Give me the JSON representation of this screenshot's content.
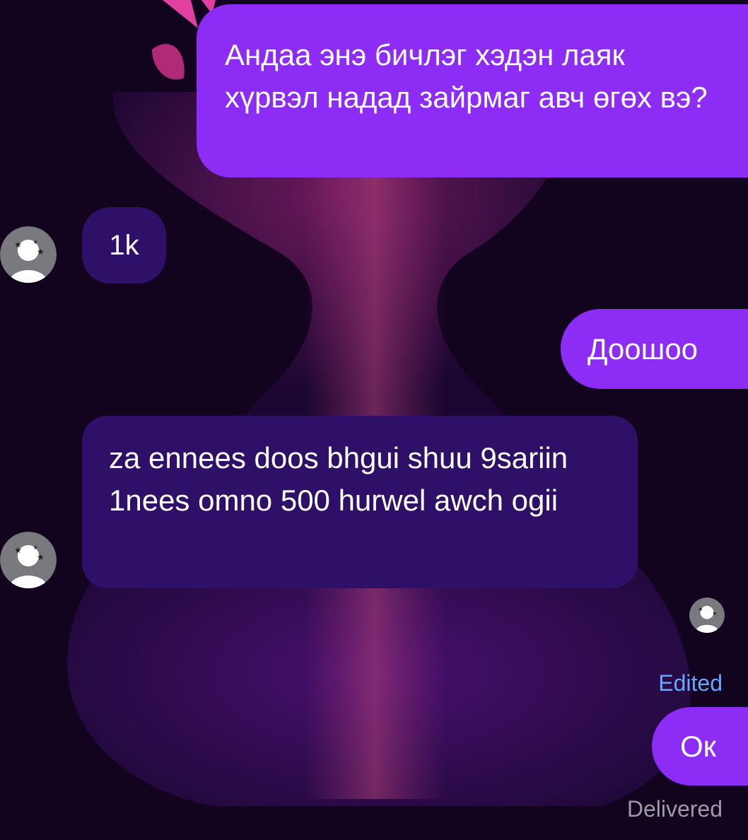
{
  "messages": [
    {
      "id": "m1",
      "direction": "outgoing",
      "text": "Андаа энэ бичлэг хэдэн лаяк хүрвэл надад зайрмаг авч өгөх вэ?"
    },
    {
      "id": "m2",
      "direction": "incoming",
      "text": "1k"
    },
    {
      "id": "m3",
      "direction": "outgoing",
      "text": "Доошоо"
    },
    {
      "id": "m4",
      "direction": "incoming",
      "text": "za ennees doos bhgui shuu 9sariin 1nees omno 500 hurwel awch ogii"
    },
    {
      "id": "m5",
      "direction": "outgoing",
      "text": "Ок"
    }
  ],
  "status": {
    "edited": "Edited",
    "delivered": "Delivered"
  },
  "colors": {
    "outgoing_bubble": "#8c2cf5",
    "incoming_bubble": "#2e1068",
    "edited_text": "#6aa6ff",
    "delivered_text": "#9e9aa8",
    "background": "#12041f"
  },
  "icons": {
    "avatar": "contact-avatar-icon",
    "read_receipt": "read-receipt-avatar-icon"
  }
}
